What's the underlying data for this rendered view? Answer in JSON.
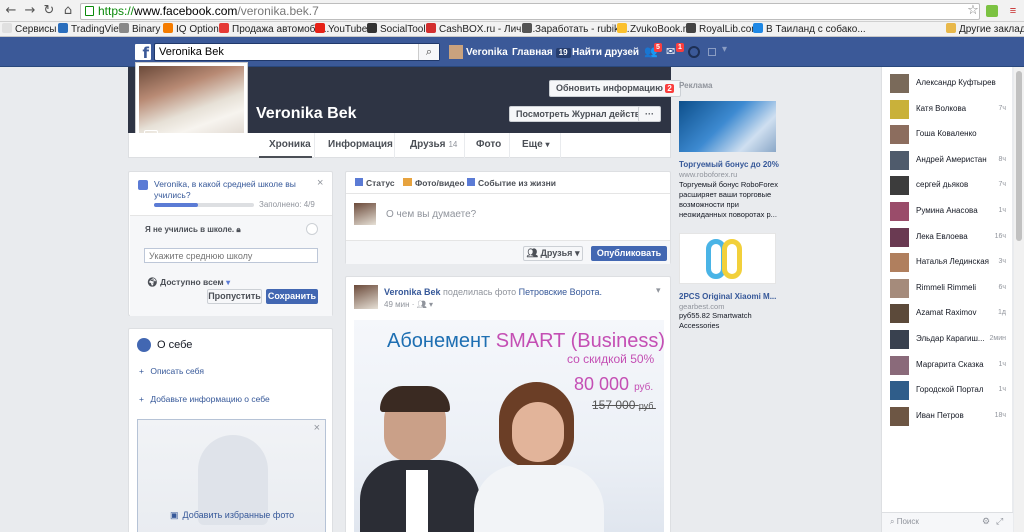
{
  "browser": {
    "url_https": "https://",
    "url_domain": "www.facebook.com",
    "url_path": "/veronika.bek.7",
    "bookmarks": [
      "Сервисы",
      "TradingView",
      "Binary",
      "IQ Option",
      "Продажа автомоби...",
      "YouTube",
      "SocialTools",
      "CashBOX.ru - Личн...",
      "Заработать - rubikl...",
      "ZvukoBook.ru",
      "RoyalLib.com",
      "В Таиланд с собако..."
    ],
    "other_bookmarks": "Другие закладки"
  },
  "fbheader": {
    "search_value": "Veronika Bek",
    "user": "Veronika",
    "home": "Главная",
    "home_count": "19",
    "find_friends": "Найти друзей",
    "friend_badge": "5",
    "msg_badge": "1"
  },
  "profile": {
    "name": "Veronika Bek",
    "update_info": "Обновить информацию",
    "update_badge": "2",
    "activity_log": "Посмотреть Журнал действий",
    "more_dots": "···",
    "tabs": [
      {
        "label": "Хроника",
        "count": ""
      },
      {
        "label": "Информация",
        "count": ""
      },
      {
        "label": "Друзья",
        "count": "14"
      },
      {
        "label": "Фото",
        "count": ""
      },
      {
        "label": "Еще",
        "count": ""
      }
    ]
  },
  "school_card": {
    "question": "Veronika, в какой средней школе вы учились?",
    "progress": 0.44,
    "filled": "Заполнено: 4/9",
    "no_school": "Я не учились в школе.",
    "input_placeholder": "Укажите среднюю школу",
    "privacy": "Доступно всем",
    "skip": "Пропустить",
    "save": "Сохранить"
  },
  "about": {
    "title": "О себе",
    "describe": "Описать себя",
    "add_info": "Добавьте информацию о себе",
    "add_photos": "Добавить избранные фото"
  },
  "composer": {
    "status": "Статус",
    "photo": "Фото/видео",
    "event": "Событие из жизни",
    "placeholder": "О чем вы думаете?",
    "audience": "Друзья",
    "publish": "Опубликовать"
  },
  "post": {
    "author": "Veronika Bek",
    "action": "поделилась фото",
    "target": "Петровские Ворота.",
    "time": "49 мин",
    "ad_line1": "Абонемент",
    "ad_line1b": "SMART (Business)",
    "ad_line2": "со скидкой 50%",
    "price_new": "80 000",
    "price_unit": "руб.",
    "price_old": "157 000",
    "price_old_unit": "руб."
  },
  "ads": {
    "section": "Реклама",
    "items": [
      {
        "title": "Торгуемый бонус до 20%",
        "site": "www.roboforex.ru",
        "text": "Торгуемый бонус RoboForex расширяет ваши торговые возможности при неожиданных поворотах р..."
      },
      {
        "title": "2PCS Original Xiaomi M...",
        "site": "gearbest.com",
        "text": "руб55.82 Smartwatch Accessories"
      }
    ]
  },
  "chat": {
    "contacts": [
      {
        "name": "Александр Куфтырев",
        "time": ""
      },
      {
        "name": "Катя Волкова",
        "time": "7ч"
      },
      {
        "name": "Гоша Коваленко",
        "time": ""
      },
      {
        "name": "Андрей Америстан",
        "time": "8ч"
      },
      {
        "name": "сергей дьяков",
        "time": "7ч"
      },
      {
        "name": "Румина Анасова",
        "time": "1ч"
      },
      {
        "name": "Лека Евлоева",
        "time": "16ч"
      },
      {
        "name": "Наталья Лединская",
        "time": "3ч"
      },
      {
        "name": "Rimmeli Rimmeli",
        "time": "6ч"
      },
      {
        "name": "Azamat Raximov",
        "time": "1д"
      },
      {
        "name": "Эльдар Карагиш...",
        "time": "2мин"
      },
      {
        "name": "Маргарита Сказка",
        "time": "1ч"
      },
      {
        "name": "Городской Портал",
        "time": "1ч"
      },
      {
        "name": "Иван Петров",
        "time": "18ч"
      }
    ],
    "search_placeholder": "Поиск"
  }
}
